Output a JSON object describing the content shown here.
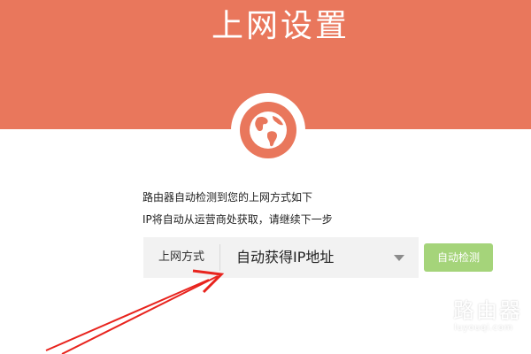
{
  "header": {
    "title": "上网设置",
    "background_color": "#e9775c",
    "globe_icon": "globe-icon"
  },
  "messages": {
    "line1": "路由器自动检测到您的上网方式如下",
    "line2": "IP将自动从运营商处获取，请继续下一步"
  },
  "connection": {
    "label": "上网方式",
    "selected": "自动获得IP地址",
    "dropdown_icon": "caret-down-icon"
  },
  "detect_button": {
    "label": "自动检测",
    "color": "#a5d47a"
  },
  "annotation": {
    "arrow_color": "#e8231d"
  },
  "watermark": {
    "text": "路由器",
    "domain": "luyouqi.com"
  }
}
